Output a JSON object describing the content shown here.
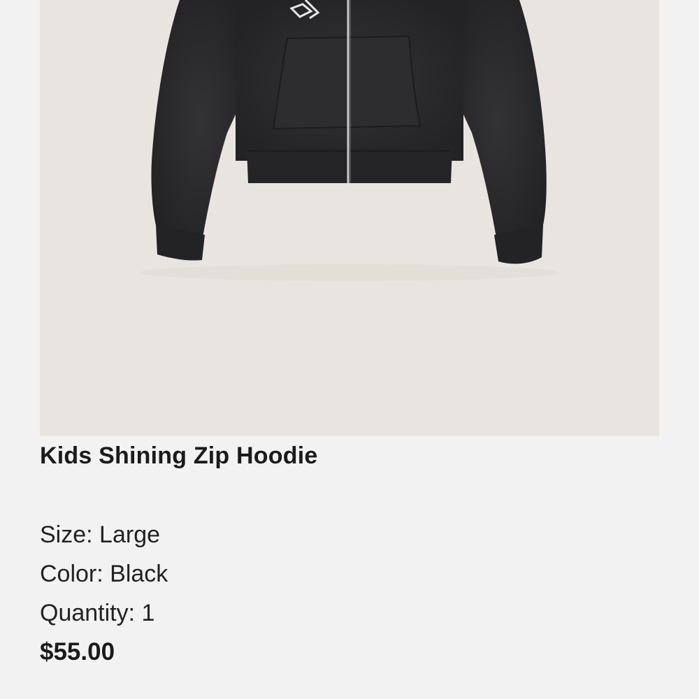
{
  "product": {
    "name": "Kids Shining Zip Hoodie",
    "image_icon": "hoodie-product-photo",
    "details": {
      "size_label": "Size:",
      "size_value": "Large",
      "color_label": "Color:",
      "color_value": "Black",
      "quantity_label": "Quantity:",
      "quantity_value": "1"
    },
    "price": "$55.00"
  },
  "colors": {
    "page_background": "#f2f2f2",
    "image_background": "#e8e5e0",
    "garment": "#2a292b",
    "text": "#1b1b1b"
  }
}
